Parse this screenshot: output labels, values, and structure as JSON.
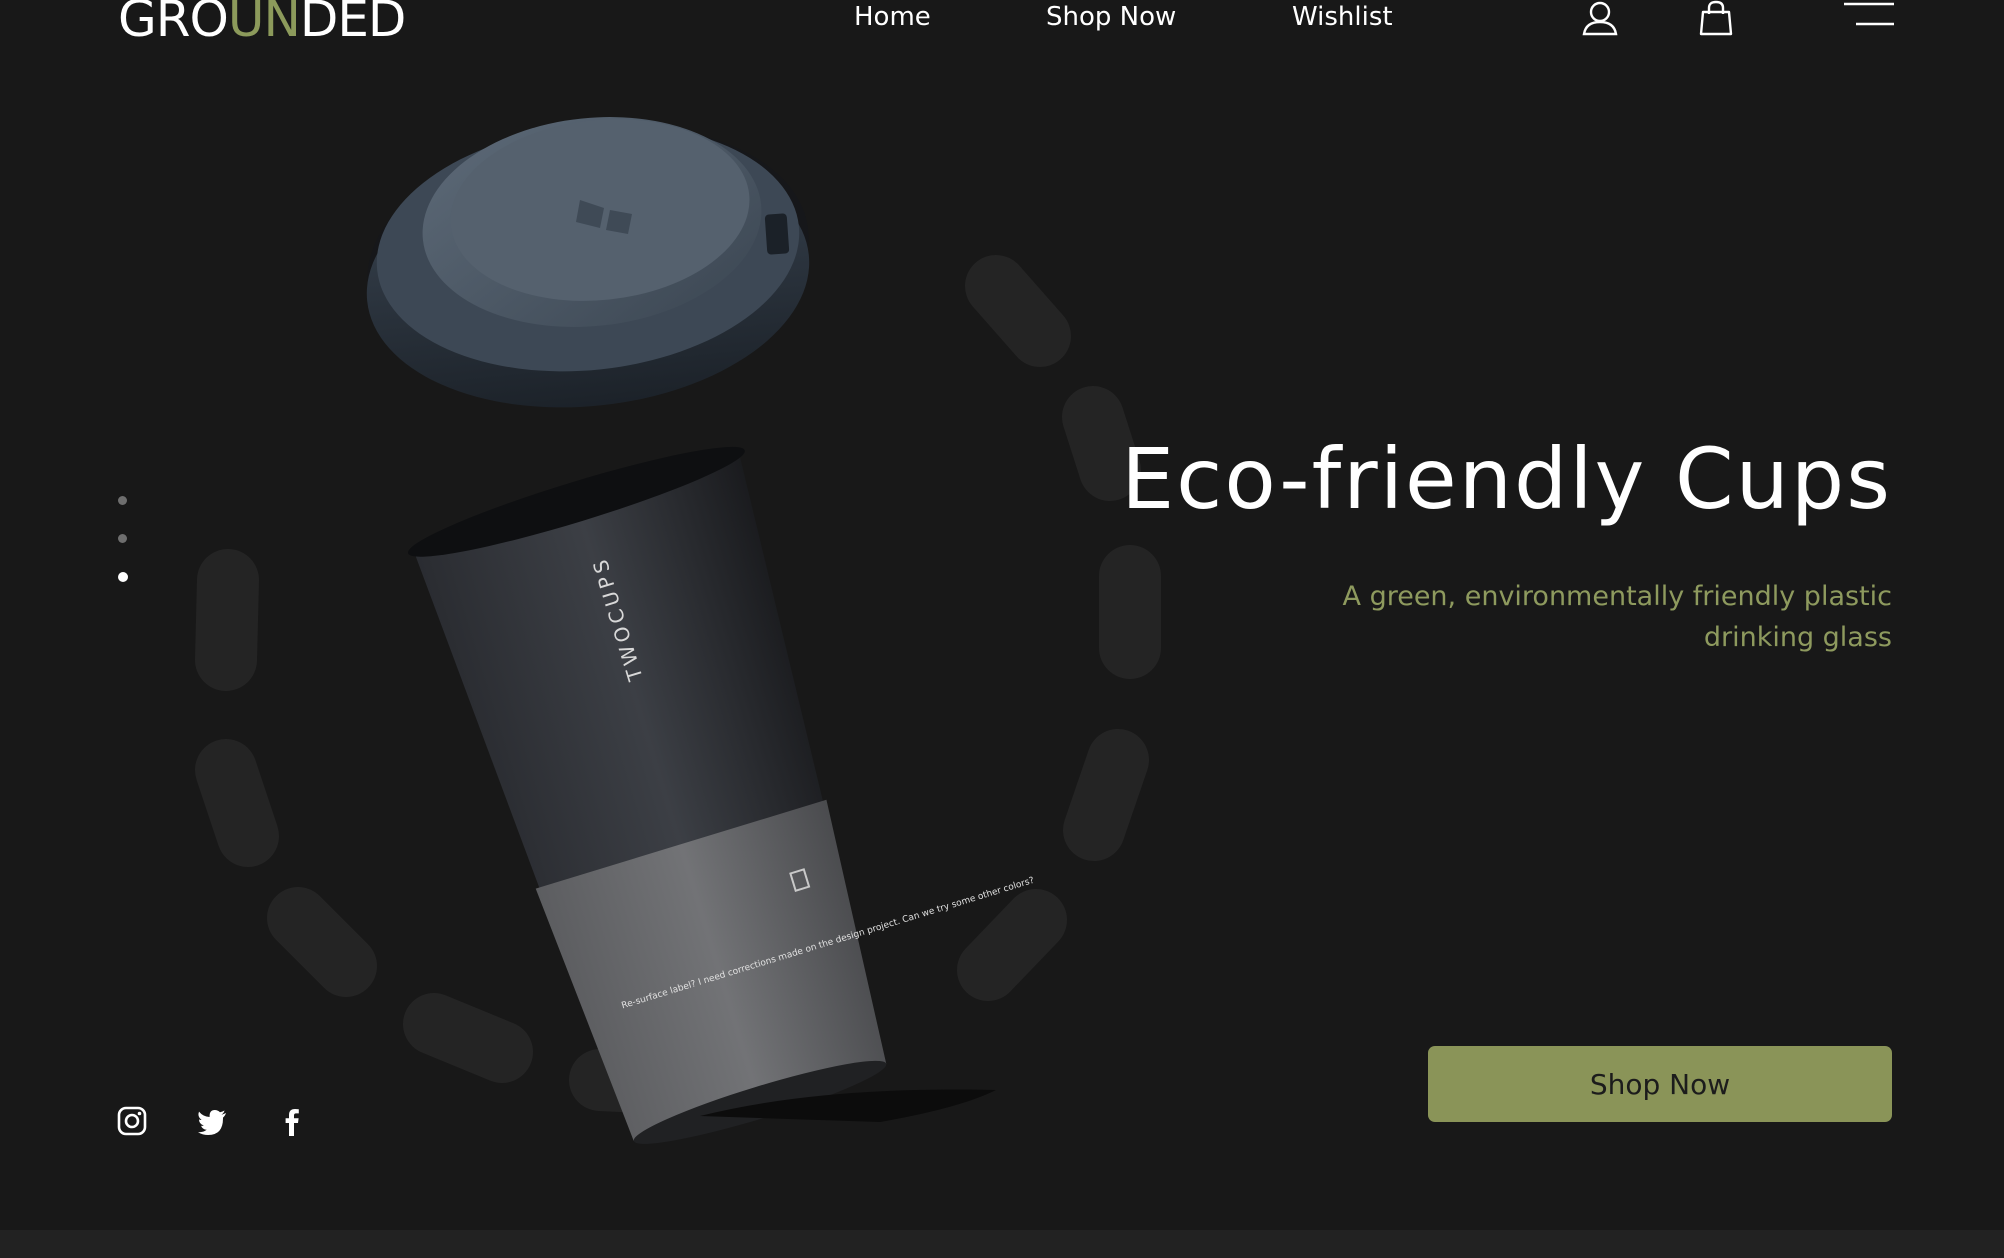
{
  "brand": {
    "logo_prefix": "GRO",
    "logo_accent": "UN",
    "logo_suffix": "DED"
  },
  "nav": {
    "links": [
      "Home",
      "Shop Now",
      "Wishlist"
    ]
  },
  "icons": {
    "header": [
      "user-icon",
      "shopping-bag-icon",
      "menu-icon"
    ],
    "social": [
      "instagram-icon",
      "twitter-icon",
      "facebook-icon"
    ]
  },
  "carousel": {
    "total": 3,
    "active_index": 2
  },
  "hero": {
    "title": "Eco-friendly Cups",
    "subtitle": "A green, environmentally friendly plastic drinking glass",
    "cta_label": "Shop Now"
  },
  "product": {
    "cup_brand": "TWOCUPS",
    "cup_fine_print": "Re-surface label? I need corrections made on the design project. Can we try some other colors?"
  },
  "colors": {
    "background": "#181818",
    "accent": "#8c9a5b",
    "button": "#8a9458",
    "text": "#ffffff"
  }
}
